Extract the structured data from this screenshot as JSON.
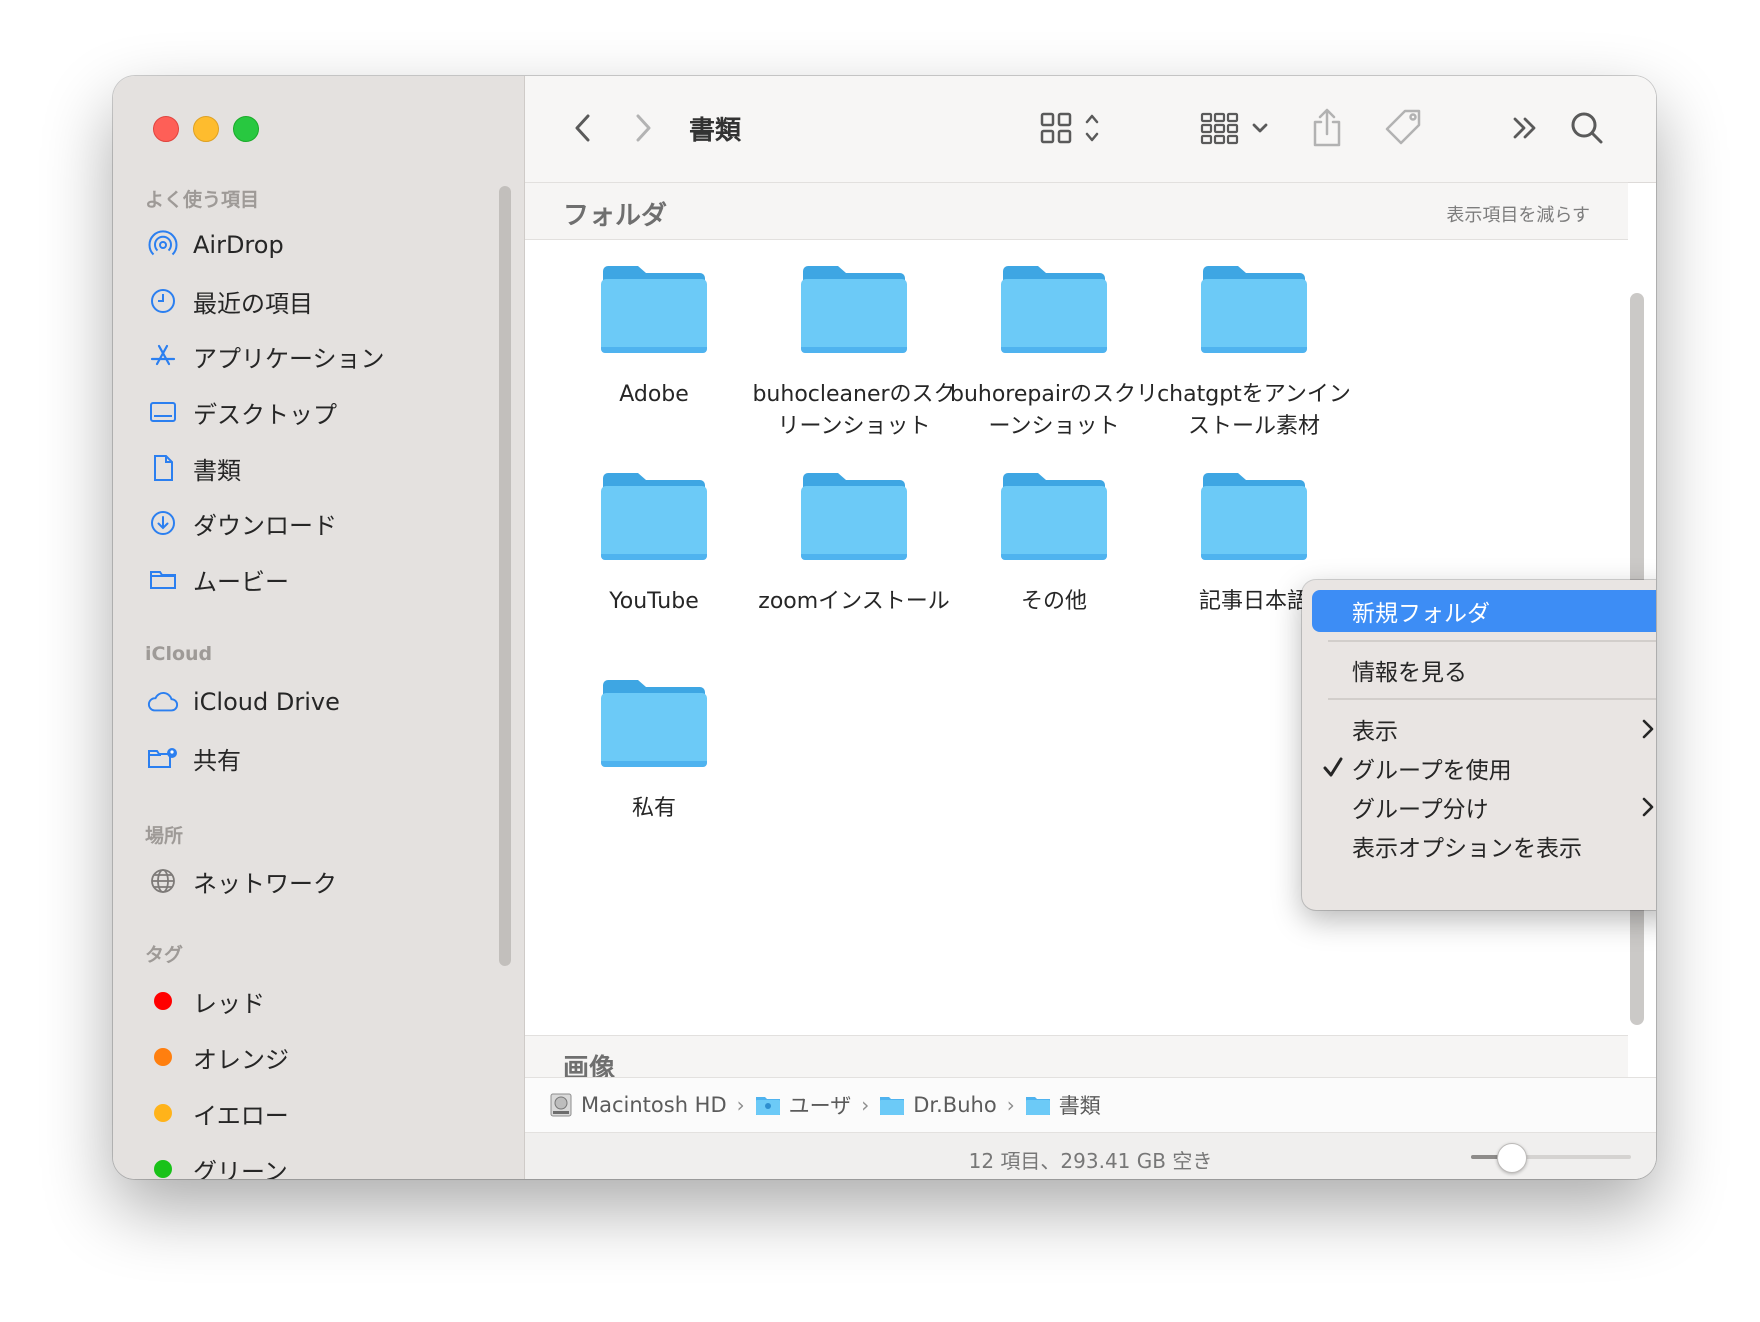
{
  "sidebar": {
    "sections": {
      "favorites": "よく使う項目",
      "icloud": "iCloud",
      "locations": "場所",
      "tags": "タグ"
    },
    "favorites": [
      {
        "label": "AirDrop",
        "icon": "airdrop-icon"
      },
      {
        "label": "最近の項目",
        "icon": "clock-icon"
      },
      {
        "label": "アプリケーション",
        "icon": "applications-icon"
      },
      {
        "label": "デスクトップ",
        "icon": "desktop-icon"
      },
      {
        "label": "書類",
        "icon": "document-icon"
      },
      {
        "label": "ダウンロード",
        "icon": "download-icon"
      },
      {
        "label": "ムービー",
        "icon": "folder-icon"
      }
    ],
    "icloud": [
      {
        "label": "iCloud Drive",
        "icon": "cloud-icon"
      },
      {
        "label": "共有",
        "icon": "shared-folder-icon"
      }
    ],
    "locations": [
      {
        "label": "ネットワーク",
        "icon": "globe-icon"
      }
    ],
    "tags": [
      {
        "label": "レッド",
        "color": "#ff0000"
      },
      {
        "label": "オレンジ",
        "color": "#ff7f0f"
      },
      {
        "label": "イエロー",
        "color": "#ffb31a"
      },
      {
        "label": "グリーン",
        "color": "#19c219"
      }
    ]
  },
  "toolbar": {
    "title": "書類"
  },
  "groups": {
    "folders": {
      "title": "フォルダ",
      "action": "表示項目を減らす"
    },
    "images": {
      "title": "画像"
    }
  },
  "folders": [
    {
      "name": "Adobe"
    },
    {
      "name": "buhocleanerのスクリーンショット"
    },
    {
      "name": "buhorepairのスクリーンショット"
    },
    {
      "name": "chatgptをアンインストール素材"
    },
    {
      "name": "YouTube"
    },
    {
      "name": "zoomインストール"
    },
    {
      "name": "その他"
    },
    {
      "name": "記事日本語"
    },
    {
      "name": "私有"
    }
  ],
  "pathbar": [
    {
      "label": "Macintosh HD",
      "icon": "hard-drive-icon"
    },
    {
      "label": "ユーザ",
      "icon": "users-folder-icon"
    },
    {
      "label": "Dr.Buho",
      "icon": "folder-icon"
    },
    {
      "label": "書類",
      "icon": "folder-icon"
    }
  ],
  "status": {
    "text": "12 項目、293.41 GB 空き",
    "zoom_level": 0.25
  },
  "context_menu": {
    "items": [
      {
        "label": "新規フォルダ",
        "highlighted": true
      },
      {
        "label": "情報を見る"
      },
      {
        "label": "表示",
        "submenu": true
      },
      {
        "label": "グループを使用",
        "checked": true
      },
      {
        "label": "グループ分け",
        "submenu": true
      },
      {
        "label": "表示オプションを表示"
      }
    ]
  },
  "colors": {
    "accent": "#3d8df5",
    "folder": "#6ccaf7",
    "folder_tab": "#3ea6e3",
    "sidebar_icon": "#2b7ff0"
  }
}
